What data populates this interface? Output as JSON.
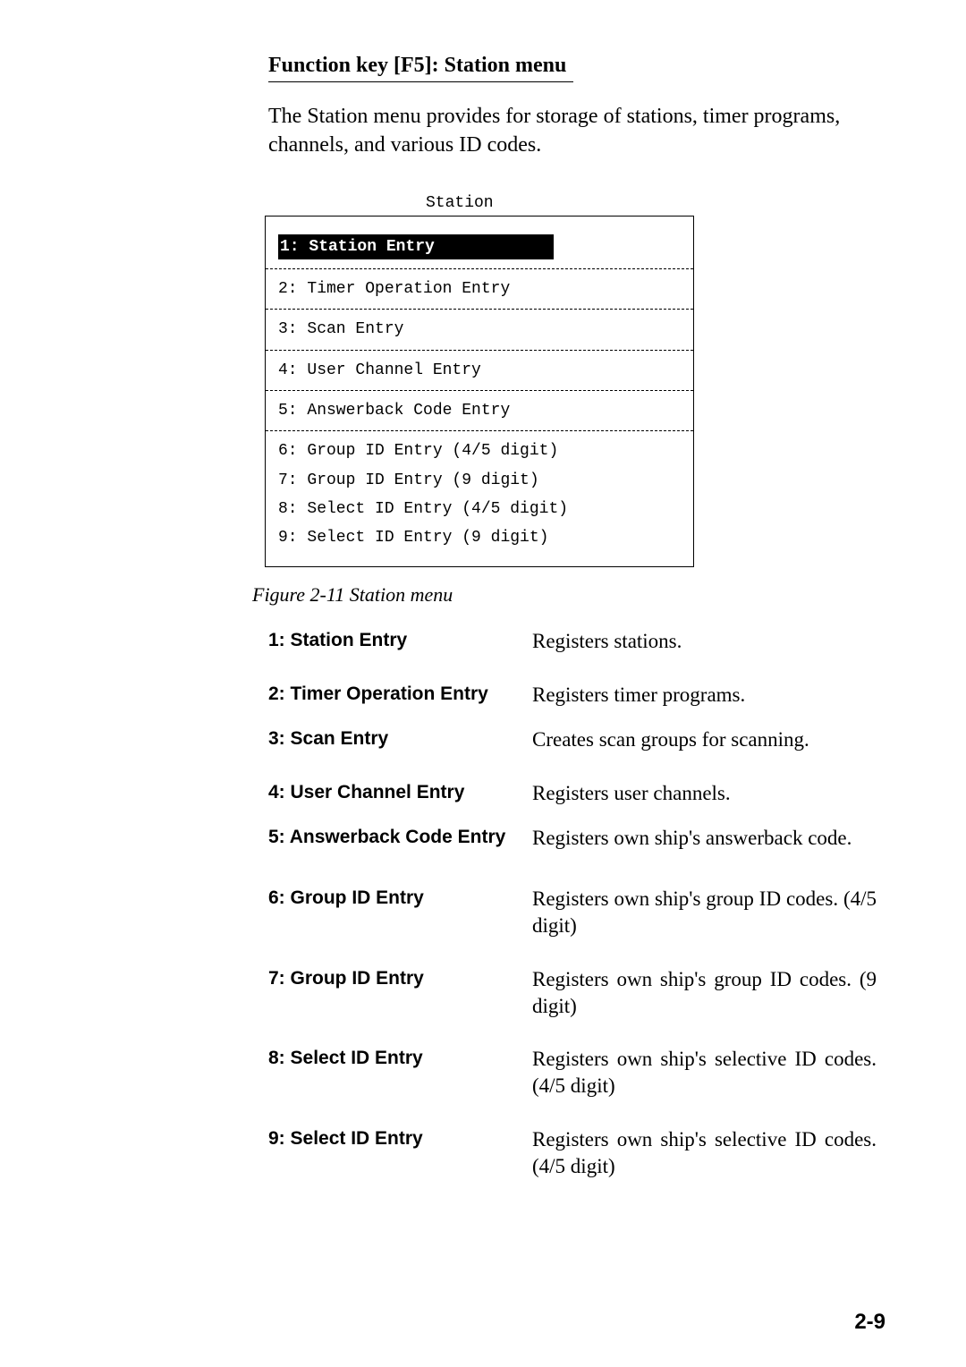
{
  "heading": "Function key [F5]: Station menu",
  "intro": "The Station menu provides for storage of stations, timer programs, channels, and various ID codes.",
  "station_figure": {
    "title": "Station",
    "item1": "1: Station Entry",
    "item2": "2: Timer Operation Entry",
    "item3": "3: Scan Entry",
    "item4": "4: User Channel Entry",
    "item5": "5: Answerback Code Entry",
    "item6": "6: Group ID Entry (4/5 digit)",
    "item7": "7: Group ID Entry (9 digit)",
    "item8": "8: Select ID Entry (4/5 digit)",
    "item9": "9: Select ID Entry (9 digit)"
  },
  "caption": "Figure 2-11 Station menu",
  "defs": {
    "e1": {
      "label": "1: Station Entry",
      "desc": "Registers stations."
    },
    "e2": {
      "label": "2: Timer Operation Entry",
      "desc": "Registers timer programs."
    },
    "e3": {
      "label": "3: Scan Entry",
      "desc": "Creates scan groups for scanning."
    },
    "e4": {
      "label": "4: User Channel Entry",
      "desc": "Registers user channels."
    },
    "e5": {
      "label": "5: Answerback Code Entry",
      "desc": "Registers own ship's answerback code."
    },
    "e6": {
      "label": "6: Group ID Entry",
      "desc": "Registers own ship's group ID codes. (4/5 digit)"
    },
    "e7": {
      "label": "7: Group ID Entry",
      "desc": "Registers own ship's group ID codes. (9 digit)"
    },
    "e8": {
      "label": "8: Select ID Entry",
      "desc": "Registers own ship's selective ID codes. (4/5 digit)"
    },
    "e9": {
      "label": "9: Select ID Entry",
      "desc": "Registers own ship's selective ID codes. (4/5 digit)"
    }
  },
  "page_number": "2-9"
}
